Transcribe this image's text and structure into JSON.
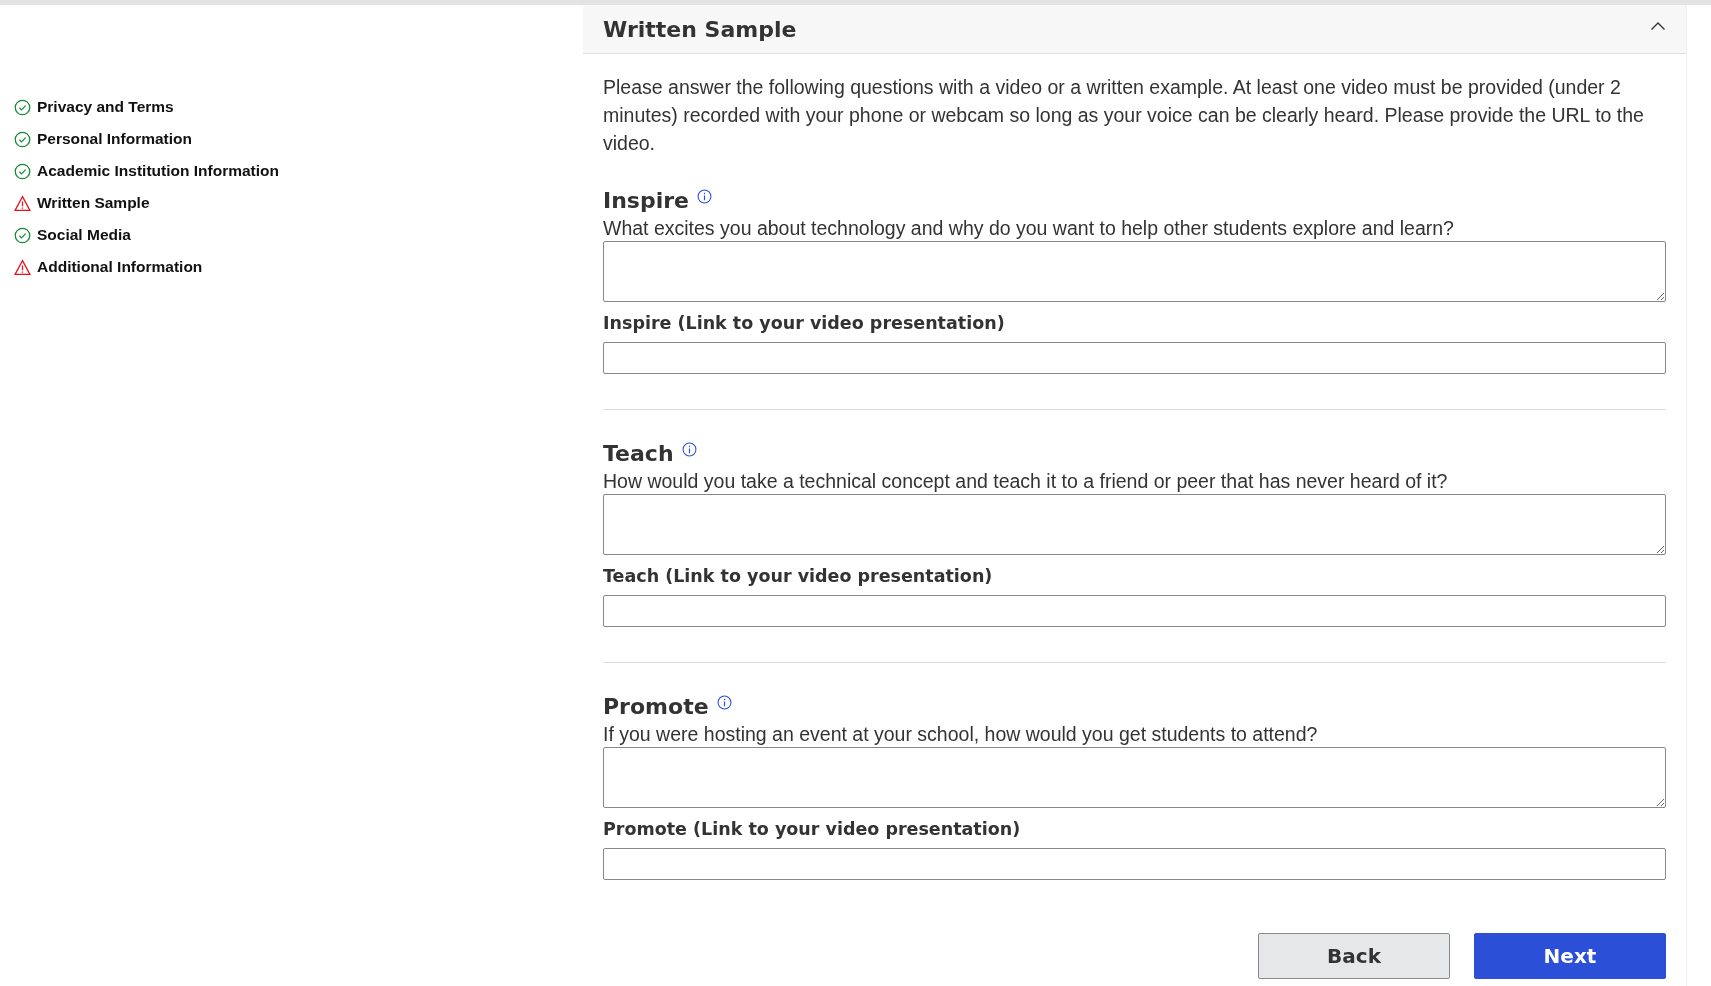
{
  "sidebar": {
    "items": [
      {
        "label": "Privacy and Terms",
        "kind": "complete"
      },
      {
        "label": "Personal Information",
        "kind": "complete"
      },
      {
        "label": "Academic Institution Information",
        "kind": "complete"
      },
      {
        "label": "Written Sample",
        "kind": "warning"
      },
      {
        "label": "Social Media",
        "kind": "complete"
      },
      {
        "label": "Additional Information",
        "kind": "warning"
      }
    ]
  },
  "panel": {
    "title": "Written Sample",
    "expanded": true,
    "intro": "Please answer the following questions with a video or a written example. At least one video must be provided (under 2 minutes) recorded with your phone or webcam so long as your voice can be clearly heard. Please provide the URL to the video.",
    "sections": [
      {
        "title": "Inspire",
        "question": "What excites you about technology and why do you want to help other students explore and learn?",
        "link_label": "Inspire (Link to your video presentation)"
      },
      {
        "title": "Teach",
        "question": "How would you take a technical concept and teach it to a friend or peer that has never heard of it?",
        "link_label": "Teach (Link to your video presentation)"
      },
      {
        "title": "Promote",
        "question": "If you were hosting an event at your school, how would you get students to attend?",
        "link_label": "Promote (Link to your video presentation)"
      }
    ]
  },
  "buttons": [
    {
      "label": "Back",
      "kind": "secondary"
    },
    {
      "label": "Next",
      "kind": "primary"
    }
  ]
}
